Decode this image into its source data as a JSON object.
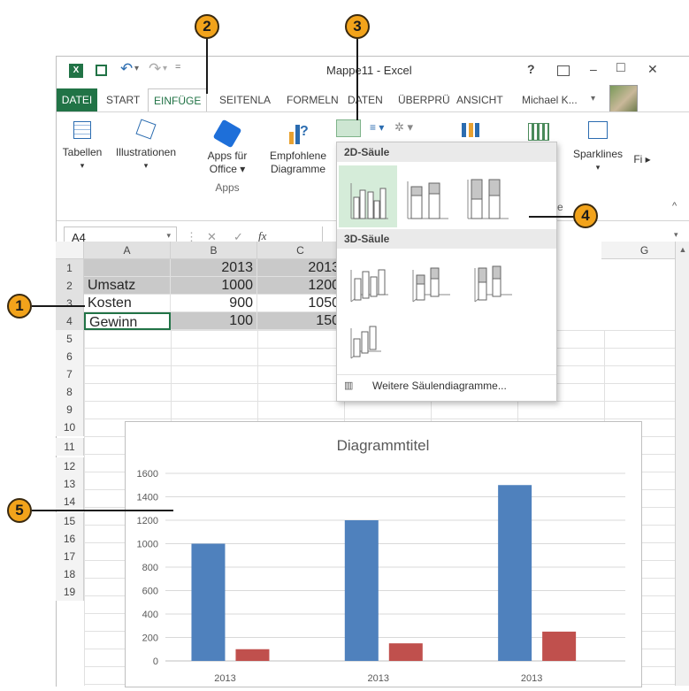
{
  "callouts": [
    "1",
    "2",
    "3",
    "4",
    "5"
  ],
  "title_bar": {
    "title": "Mappe11 - Excel",
    "help": "?",
    "undo_arrow": "↶",
    "redo_arrow": "↷",
    "qa_drop": "▾ ",
    "minimize": "–",
    "maximize": "□",
    "close": "✕"
  },
  "tabs": {
    "file": "DATEI",
    "items": [
      "START",
      "EINFÜGE",
      "SEITENLA",
      "FORMELN",
      "DATEN",
      "ÜBERPRÜ",
      "ANSICHT"
    ],
    "user": "Michael K...",
    "user_arrow": "▾"
  },
  "ribbon": {
    "tables": "Tabellen",
    "illustrations": "Illustrationen",
    "apps_for_office": "Apps für",
    "apps_for_office_2": "Office",
    "apps_group": "Apps",
    "recommended": "Empfohlene",
    "recommended_2": "Diagramme",
    "sparklines": "Sparklines",
    "filter": "Fi",
    "group_tail": "e"
  },
  "formula_bar": {
    "name_box": "A4",
    "cancel": "✕",
    "enter": "✓",
    "fx": "fx"
  },
  "grid": {
    "columns": [
      "A",
      "B",
      "C",
      "G"
    ],
    "row_numbers": [
      "1",
      "2",
      "3",
      "4",
      "5",
      "6",
      "7",
      "8",
      "9",
      "10",
      "11",
      "12",
      "13",
      "14",
      "15",
      "16",
      "17",
      "18",
      "19"
    ],
    "rows": [
      {
        "a": "",
        "b": "2013",
        "c": "2013"
      },
      {
        "a": "Umsatz",
        "b": "1000",
        "c": "1200"
      },
      {
        "a": "Kosten",
        "b": "900",
        "c": "1050"
      },
      {
        "a": "Gewinn",
        "b": "100",
        "c": "150"
      }
    ]
  },
  "dropdown": {
    "section_2d": "2D-Säule",
    "section_3d": "3D-Säule",
    "more": "Weitere Säulendiagramme..."
  },
  "chart_data": {
    "type": "bar",
    "title": "Diagrammtitel",
    "categories": [
      "2013",
      "2013",
      "2013"
    ],
    "series": [
      {
        "values": [
          1000,
          1200,
          1500
        ],
        "color": "#4f81bd"
      },
      {
        "values": [
          100,
          150,
          250
        ],
        "color": "#c0504d"
      }
    ],
    "y_ticks": [
      "0",
      "200",
      "400",
      "600",
      "800",
      "1000",
      "1200",
      "1400",
      "1600"
    ],
    "ylim": [
      0,
      1600
    ],
    "grid": true,
    "legend": "none"
  },
  "colors": {
    "excel_green": "#217346",
    "callout": "#f2a31b",
    "selected_gray": "#c9c9c9",
    "hover_green": "#d5ecd9"
  }
}
